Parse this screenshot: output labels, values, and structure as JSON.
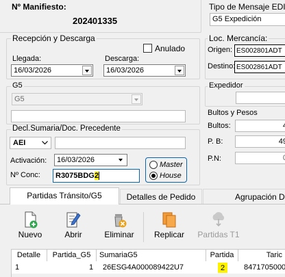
{
  "manifiesto": {
    "label": "Nº Manifiesto:",
    "value": "202401335"
  },
  "tipo_mensaje": {
    "label": "Tipo de Mensaje EDI",
    "value": "G5 Expedición"
  },
  "recepcion": {
    "title": "Recepción y Descarga",
    "anulado_label": "Anulado",
    "llegada_label": "Llegada:",
    "llegada_value": "16/03/2026",
    "descarga_label": "Descarga:",
    "descarga_value": "16/03/2026"
  },
  "loc_mercancia": {
    "title": "Loc. Mercancía:",
    "origen_label": "Origen:",
    "origen_value": "ES002801ADT",
    "destino_label": "Destino:",
    "destino_value": "ES002861ADT"
  },
  "g5": {
    "title": "G5",
    "select_value": "G5",
    "text_value": ""
  },
  "expedidor": {
    "title": "Expedidor",
    "value": ""
  },
  "bultos": {
    "title": "Bultos y Pesos",
    "bultos_label": "Bultos:",
    "bultos_value": "4",
    "pb_label": "P. B:",
    "pb_value": "49",
    "pn_label": "P.N:",
    "pn_value": "0"
  },
  "decl": {
    "title": "Decl.Sumaria/Doc. Precedente",
    "type_value": "AEI",
    "doc_value": "",
    "activacion_label": "Activación:",
    "activacion_value": "16/03/2026",
    "conc_label": "Nº Conc:",
    "conc_value_main": "R3075BDG",
    "conc_value_highlight": "2",
    "master_label": "Master",
    "house_label": "House",
    "selected": "House"
  },
  "tabs": [
    {
      "label": "Partidas Tránsito/G5",
      "active": true
    },
    {
      "label": "Detalles de Pedido",
      "active": false
    },
    {
      "label": "Agrupación D",
      "active": false
    }
  ],
  "toolbar": {
    "nuevo": "Nuevo",
    "abrir": "Abrir",
    "eliminar": "Eliminar",
    "replicar": "Replicar",
    "partidas_t1": "Partidas T1"
  },
  "grid": {
    "columns": [
      "Detalle",
      "Partida_G5",
      "SumariaG5",
      "Partida",
      "Taric"
    ],
    "rows": [
      {
        "detalle": "1",
        "partida_g5": "1",
        "sumaria": "26ESG4A000089422U7",
        "partida": "2",
        "taric": "8471705000"
      }
    ]
  },
  "colors": {
    "highlight": "#fff200",
    "field_border": "#7a7a7a",
    "window_bg": "#f0f0f0"
  }
}
